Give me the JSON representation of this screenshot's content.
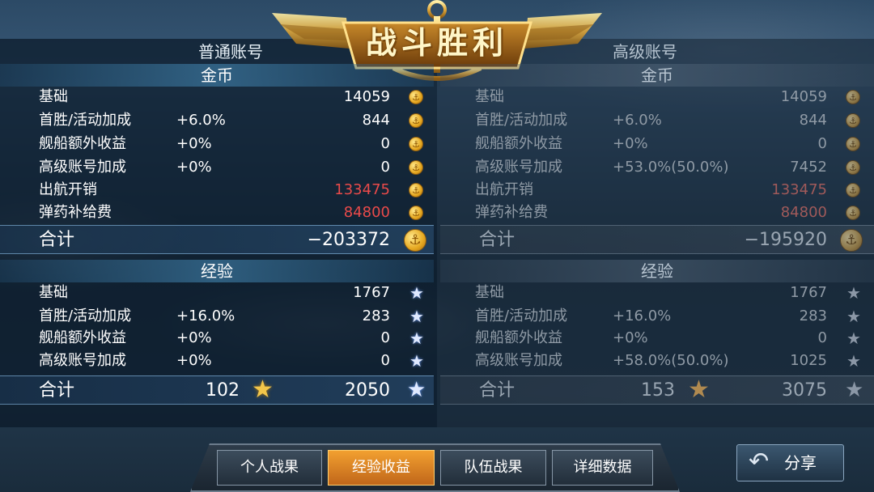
{
  "title": "战斗胜利",
  "tabs": {
    "normal": "普通账号",
    "premium": "高级账号"
  },
  "normal": {
    "gold": {
      "header": "金币",
      "rows": [
        {
          "label": "基础",
          "pct": "",
          "value": "14059",
          "negative": false
        },
        {
          "label": "首胜/活动加成",
          "pct": "+6.0%",
          "value": "844",
          "negative": false
        },
        {
          "label": "舰船额外收益",
          "pct": "+0%",
          "value": "0",
          "negative": false
        },
        {
          "label": "高级账号加成",
          "pct": "+0%",
          "value": "0",
          "negative": false
        },
        {
          "label": "出航开销",
          "pct": "",
          "value": "133475",
          "negative": true
        },
        {
          "label": "弹药补给费",
          "pct": "",
          "value": "84800",
          "negative": true
        }
      ],
      "total_label": "合计",
      "total_value": "−203372"
    },
    "exp": {
      "header": "经验",
      "rows": [
        {
          "label": "基础",
          "pct": "",
          "value": "1767"
        },
        {
          "label": "首胜/活动加成",
          "pct": "+16.0%",
          "value": "283"
        },
        {
          "label": "舰船额外收益",
          "pct": "+0%",
          "value": "0"
        },
        {
          "label": "高级账号加成",
          "pct": "+0%",
          "value": "0"
        }
      ],
      "total_label": "合计",
      "total_commander": "102",
      "total_value": "2050"
    }
  },
  "premium": {
    "gold": {
      "header": "金币",
      "rows": [
        {
          "label": "基础",
          "pct": "",
          "value": "14059",
          "negative": false
        },
        {
          "label": "首胜/活动加成",
          "pct": "+6.0%",
          "value": "844",
          "negative": false
        },
        {
          "label": "舰船额外收益",
          "pct": "+0%",
          "value": "0",
          "negative": false
        },
        {
          "label": "高级账号加成",
          "pct": "+53.0%(50.0%)",
          "value": "7452",
          "negative": false
        },
        {
          "label": "出航开销",
          "pct": "",
          "value": "133475",
          "negative": true
        },
        {
          "label": "弹药补给费",
          "pct": "",
          "value": "84800",
          "negative": true
        }
      ],
      "total_label": "合计",
      "total_value": "−195920"
    },
    "exp": {
      "header": "经验",
      "rows": [
        {
          "label": "基础",
          "pct": "",
          "value": "1767"
        },
        {
          "label": "首胜/活动加成",
          "pct": "+16.0%",
          "value": "283"
        },
        {
          "label": "舰船额外收益",
          "pct": "+0%",
          "value": "0"
        },
        {
          "label": "高级账号加成",
          "pct": "+58.0%(50.0%)",
          "value": "1025"
        }
      ],
      "total_label": "合计",
      "total_commander": "153",
      "total_value": "3075"
    }
  },
  "bottom_tabs": [
    {
      "label": "个人战果",
      "active": false
    },
    {
      "label": "经验收益",
      "active": true
    },
    {
      "label": "队伍战果",
      "active": false
    },
    {
      "label": "详细数据",
      "active": false
    }
  ],
  "share_button": "分享",
  "icons": {
    "gold": "gold-coin-icon",
    "exp": "star-icon",
    "commander_exp": "gold-star-icon",
    "share": "back-arrow-icon"
  },
  "colors": {
    "negative": "#ea4a4a",
    "active_tab": "#f2a030",
    "title": "#fff6c8"
  }
}
